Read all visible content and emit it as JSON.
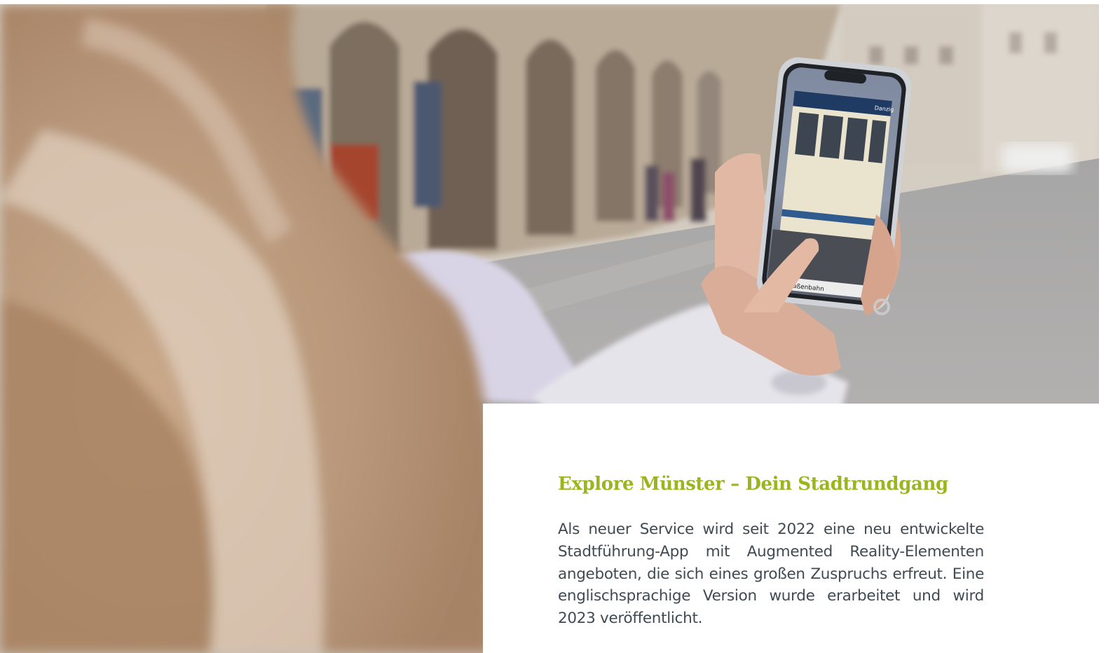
{
  "photo": {
    "description_icon": "photo-icon",
    "phone_screen_caption": "s Straßenbahn",
    "phone_screen_sign": "Danzig"
  },
  "info": {
    "title": "Explore Münster – Dein Stadtrundgang",
    "body": "Als neuer Service wird seit 2022 eine neu entwickelte Stadtführung-App mit Augmented Reality-Elementen angeboten, die sich eines großen Zuspruchs erfreut. Eine englischsprachige Version wurde erarbeitet und wird 2023 veröffentlicht."
  },
  "colors": {
    "title": "#9bb51d",
    "body_text": "#3f4a52",
    "background": "#ffffff"
  }
}
